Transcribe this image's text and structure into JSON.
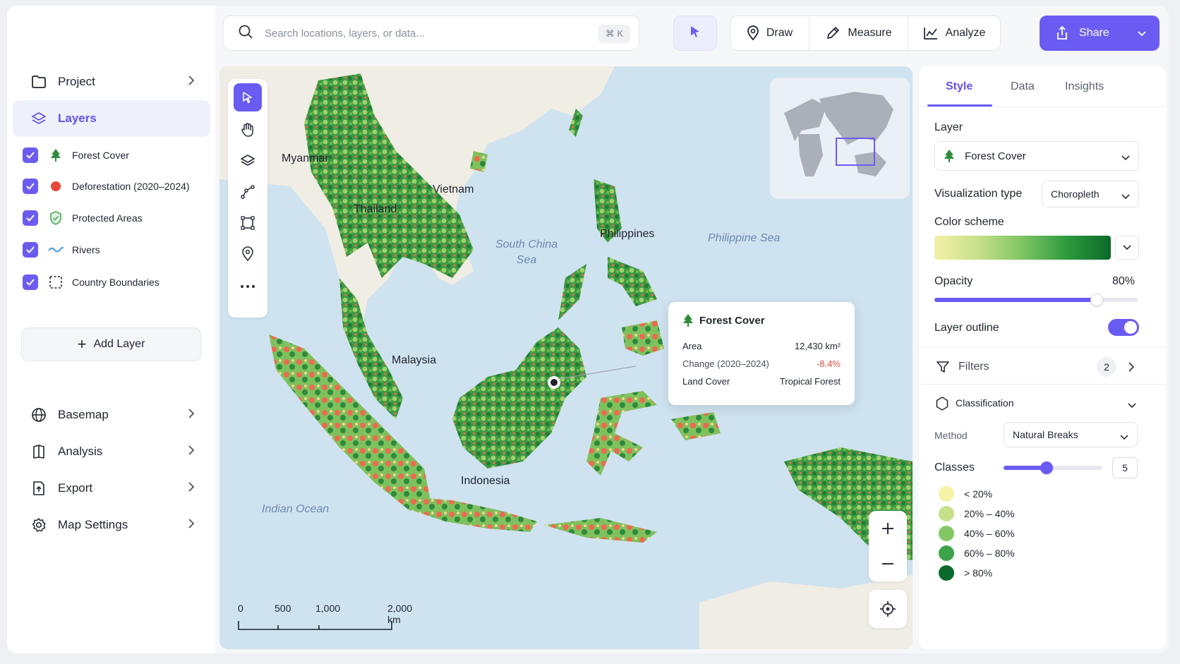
{
  "sidebar": {
    "project": "Project",
    "layers": "Layers",
    "layer_items": [
      {
        "label": "Forest Cover",
        "icon": "tree-icon"
      },
      {
        "label": "Deforestation (2020–2024)",
        "icon": "red-dot-icon"
      },
      {
        "label": "Protected Areas",
        "icon": "shield-icon"
      },
      {
        "label": "Rivers",
        "icon": "wave-icon"
      },
      {
        "label": "Country Boundaries",
        "icon": "dashed-square-icon"
      }
    ],
    "add_layer": "Add Layer",
    "bottom_items": [
      "Basemap",
      "Analysis",
      "Export",
      "Map Settings"
    ]
  },
  "toolbar": {
    "search_placeholder": "Search locations, layers, or data...",
    "shortcut": "⌘ K",
    "draw": "Draw",
    "measure": "Measure",
    "analyze": "Analyze",
    "share": "Share"
  },
  "map": {
    "countries": [
      "Myanmar",
      "Vietnam",
      "Thailand",
      "Philippines",
      "Malaysia",
      "Indonesia"
    ],
    "seas": [
      "South China Sea",
      "Philippine Sea",
      "Indian Ocean"
    ],
    "popup": {
      "title": "Forest Cover",
      "rows": [
        {
          "key": "Area",
          "value": "12,430 km²"
        },
        {
          "key": "Change (2020–2024)",
          "value": "-8.4%"
        },
        {
          "key": "Land Cover",
          "value": "Tropical Forest"
        }
      ]
    },
    "scale": {
      "labels": [
        "0",
        "500",
        "1,000",
        "2,000 km"
      ]
    },
    "colors": {
      "water": "#cfe2ef",
      "land": "#f0ede4",
      "forest_dense": "#1f7d34",
      "forest_light": "#9fd16b",
      "deforest": "#ec6a4f"
    }
  },
  "panel": {
    "tabs": [
      "Style",
      "Data",
      "Insights"
    ],
    "active_tab": "Style",
    "layer_label": "Layer",
    "layer_value": "Forest Cover",
    "viz_label": "Visualization type",
    "viz_value": "Choropleth",
    "color_scheme_label": "Color scheme",
    "opacity_label": "Opacity",
    "opacity_value": "80%",
    "opacity_level": 0.8,
    "outline_label": "Layer outline",
    "outline_on": true,
    "filters_label": "Filters",
    "filters_count": "2",
    "classification_label": "Classification",
    "method_label": "Method",
    "method_value": "Natural Breaks",
    "classes_label": "Classes",
    "classes_value": "5",
    "legend": [
      {
        "label": "< 20%",
        "color": "#f6f2a8"
      },
      {
        "label": "20% – 40%",
        "color": "#c6e08a"
      },
      {
        "label": "40% – 60%",
        "color": "#84c865"
      },
      {
        "label": "60% – 80%",
        "color": "#3ea34a"
      },
      {
        "label": "> 80%",
        "color": "#0b6a2b"
      }
    ]
  }
}
